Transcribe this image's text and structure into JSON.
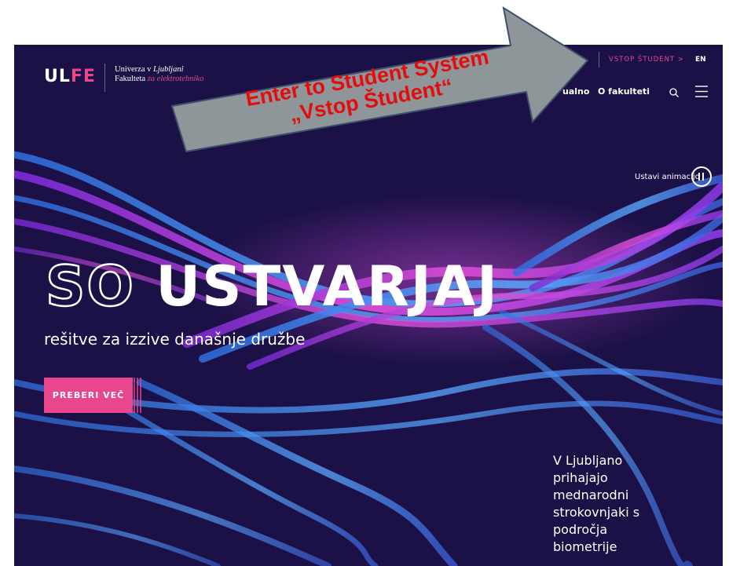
{
  "header": {
    "logo": "ULFE",
    "university_line": "Univerza v",
    "university_name": "Ljubljani",
    "faculty_line": "Fakulteta",
    "faculty_name": "za elektrotehniko",
    "student_login": "VSTOP ŠTUDENT >",
    "language": "EN",
    "nav": [
      "ualno",
      "O fakulteti"
    ],
    "icons": [
      "search-icon",
      "menu-icon"
    ]
  },
  "animation": {
    "label": "Ustavi animacijo",
    "icon": "pause-icon"
  },
  "hero": {
    "title_outline": "SO",
    "title_solid": "USTVARJAJ",
    "subtitle": "rešitve za izzive današnje družbe",
    "cta": "PREBERI VEČ"
  },
  "news": {
    "lines": [
      "V Ljubljano",
      "prihajajo",
      "mednarodni",
      "strokovnjaki s",
      "področja",
      "biometrije"
    ]
  },
  "annotation": {
    "line1": "Enter to Student System",
    "line2": "„Vstop Študent“"
  },
  "colors": {
    "background": "#1b1146",
    "accent": "#e8478e",
    "arrow_fill": "#8e969a",
    "annotation_text": "#e30d0d"
  }
}
